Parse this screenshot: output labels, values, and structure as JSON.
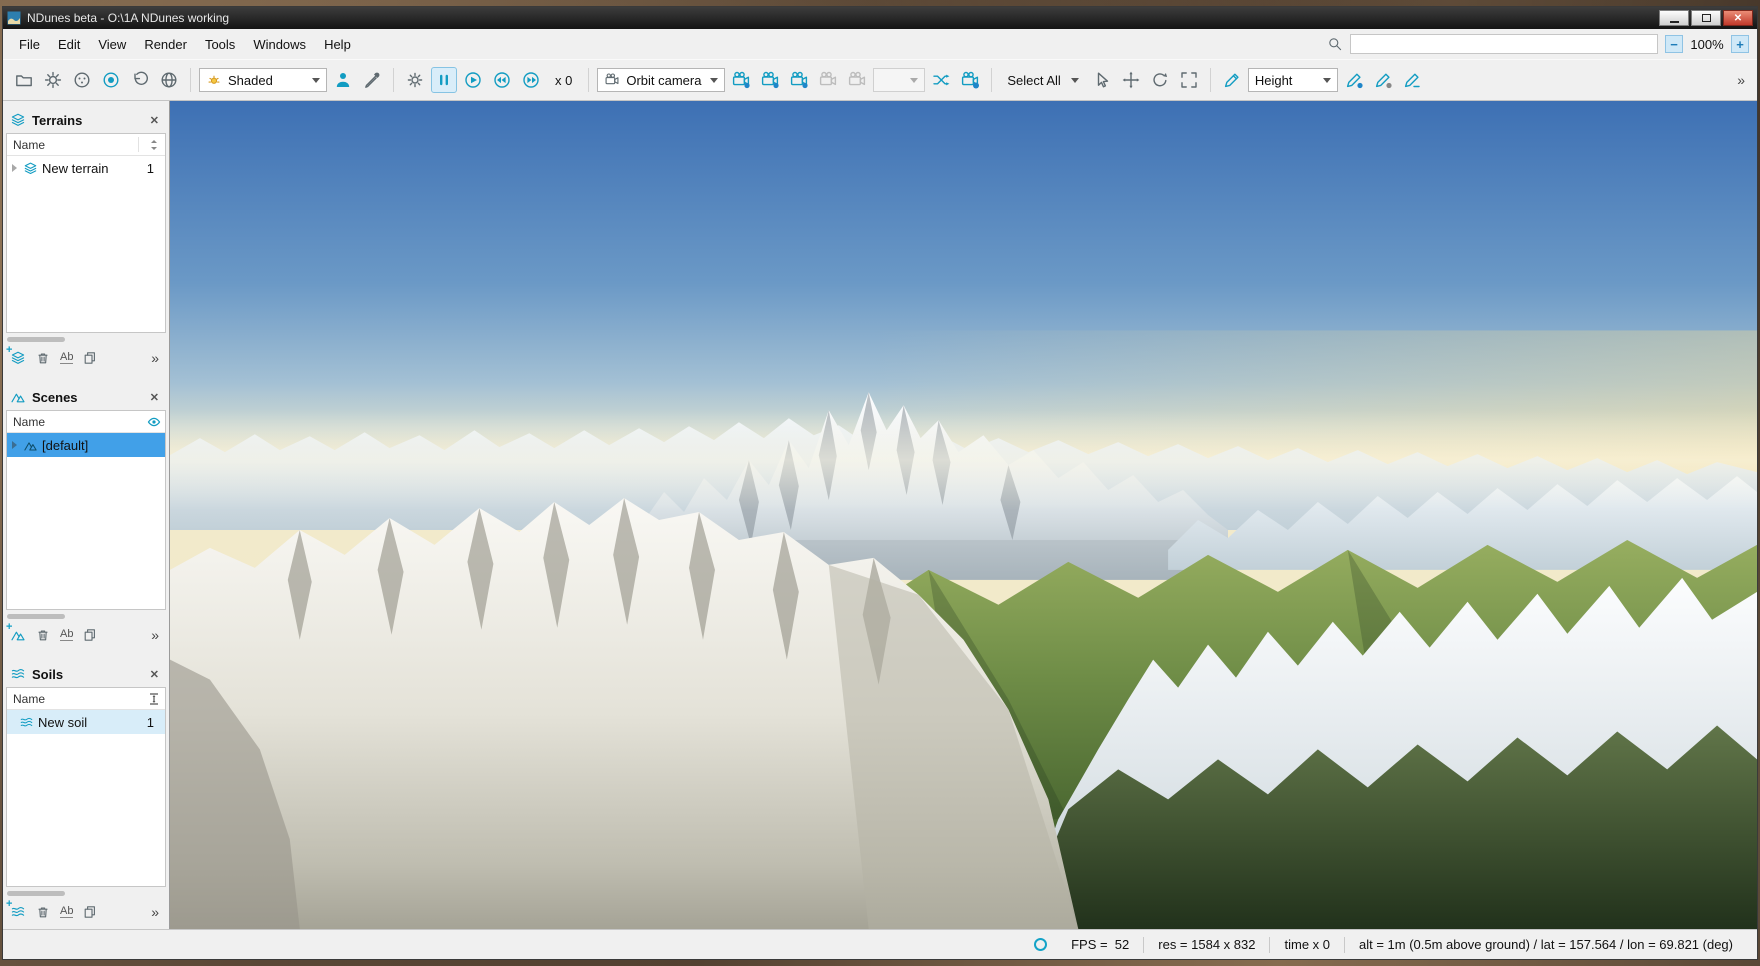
{
  "colors": {
    "accent": "#14a3c7",
    "selection": "#3d9be9",
    "close_button": "#c75050"
  },
  "window": {
    "title": "NDunes beta - O:\\1A NDunes working"
  },
  "menu": {
    "items": [
      "File",
      "Edit",
      "View",
      "Render",
      "Tools",
      "Windows",
      "Help"
    ],
    "search_value": "",
    "zoom_out": "−",
    "zoom_level": "100%",
    "zoom_in": "+"
  },
  "toolbar": {
    "shaded": "Shaded",
    "multiplier": "x 0",
    "orbit": "Orbit camera",
    "select_all": "Select All",
    "height": "Height",
    "overflow": "»"
  },
  "panels": {
    "terrains": {
      "title": "Terrains",
      "name_col": "Name",
      "row": {
        "label": "New terrain",
        "value": "1"
      }
    },
    "scenes": {
      "title": "Scenes",
      "name_col": "Name",
      "row": {
        "label": "[default]"
      }
    },
    "soils": {
      "title": "Soils",
      "name_col": "Name",
      "row": {
        "label": "New soil",
        "value": "1"
      }
    }
  },
  "icons": {
    "close": "✕",
    "overflow": "»",
    "rename": "Ab"
  },
  "statusbar": {
    "fps": "FPS =  52",
    "res": "res = 1584 x 832",
    "time": "time x 0",
    "alt": "alt = 1m (0.5m above ground) / lat = 157.564 / lon = 69.821 (deg)"
  }
}
